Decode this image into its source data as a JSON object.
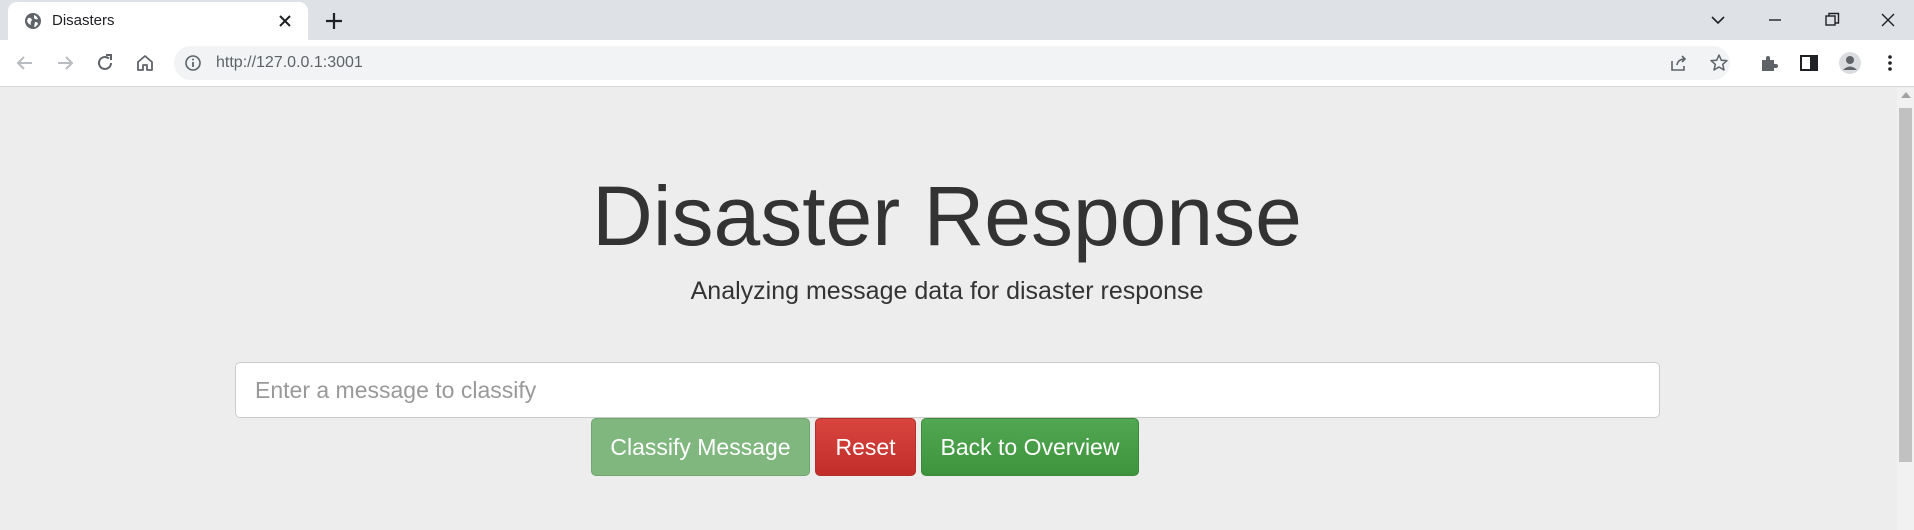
{
  "browser": {
    "tab": {
      "title": "Disasters"
    },
    "address": {
      "url": "http://127.0.0.1:3001"
    }
  },
  "page": {
    "title": "Disaster Response",
    "subtitle": "Analyzing message data for disaster response",
    "message_input": {
      "placeholder": "Enter a message to classify",
      "value": ""
    },
    "buttons": {
      "classify": "Classify Message",
      "reset": "Reset",
      "overview": "Back to Overview"
    }
  },
  "colors": {
    "page_background": "#ededed",
    "classify_button": "#7fb77f",
    "reset_button": "#c9302c",
    "overview_button": "#449d44"
  }
}
